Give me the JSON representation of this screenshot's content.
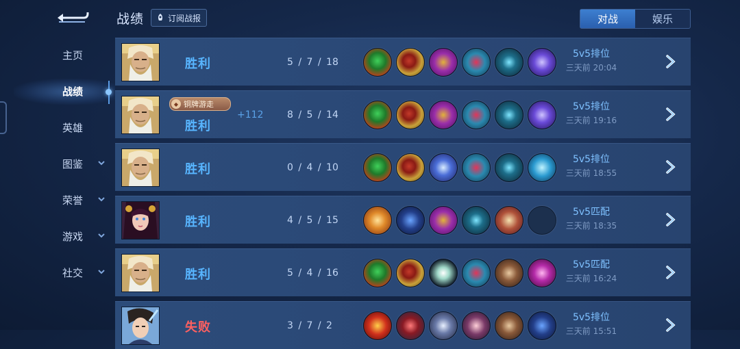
{
  "header": {
    "title": "战绩",
    "subscribe_label": "订阅战报"
  },
  "tabs": [
    {
      "label": "对战",
      "active": true
    },
    {
      "label": "娱乐",
      "active": false
    }
  ],
  "sidebar": {
    "items": [
      {
        "label": "主页",
        "expandable": false
      },
      {
        "label": "战绩",
        "expandable": false,
        "active": true
      },
      {
        "label": "英雄",
        "expandable": false
      },
      {
        "label": "图鉴",
        "expandable": true
      },
      {
        "label": "荣誉",
        "expandable": true
      },
      {
        "label": "游戏",
        "expandable": true
      },
      {
        "label": "社交",
        "expandable": true
      }
    ]
  },
  "matches": [
    {
      "hero": "old-sage",
      "result": "胜利",
      "badge": "",
      "points": "",
      "kda": "5 / 7 / 18",
      "mode": "5v5排位",
      "time": "三天前 20:04",
      "items": [
        "green",
        "gold",
        "purple",
        "teal",
        "cyan",
        "violet"
      ]
    },
    {
      "hero": "old-sage",
      "result": "胜利",
      "badge": "铜牌游走",
      "points": "+112",
      "kda": "8 / 5 / 14",
      "mode": "5v5排位",
      "time": "三天前 19:16",
      "items": [
        "green",
        "gold",
        "purple",
        "teal",
        "cyan",
        "violet"
      ]
    },
    {
      "hero": "old-sage",
      "result": "胜利",
      "badge": "",
      "points": "",
      "kda": "0 / 4 / 10",
      "mode": "5v5排位",
      "time": "三天前 18:55",
      "items": [
        "green",
        "gold",
        "blue",
        "teal",
        "cyan",
        "sky"
      ]
    },
    {
      "hero": "girl",
      "result": "胜利",
      "badge": "",
      "points": "",
      "kda": "4 / 5 / 15",
      "mode": "5v5匹配",
      "time": "三天前 18:35",
      "items": [
        "orange",
        "navy",
        "purple",
        "cyan",
        "book",
        "empty"
      ]
    },
    {
      "hero": "old-sage",
      "result": "胜利",
      "badge": "",
      "points": "",
      "kda": "5 / 4 / 16",
      "mode": "5v5匹配",
      "time": "三天前 16:24",
      "items": [
        "green",
        "gold",
        "white",
        "teal",
        "armor",
        "magenta"
      ]
    },
    {
      "hero": "boy",
      "result": "失败",
      "badge": "",
      "points": "",
      "kda": "3 / 7 / 2",
      "mode": "5v5排位",
      "time": "三天前 15:51",
      "items": [
        "red",
        "crimson",
        "steel",
        "axe",
        "armor",
        "navy"
      ]
    }
  ]
}
